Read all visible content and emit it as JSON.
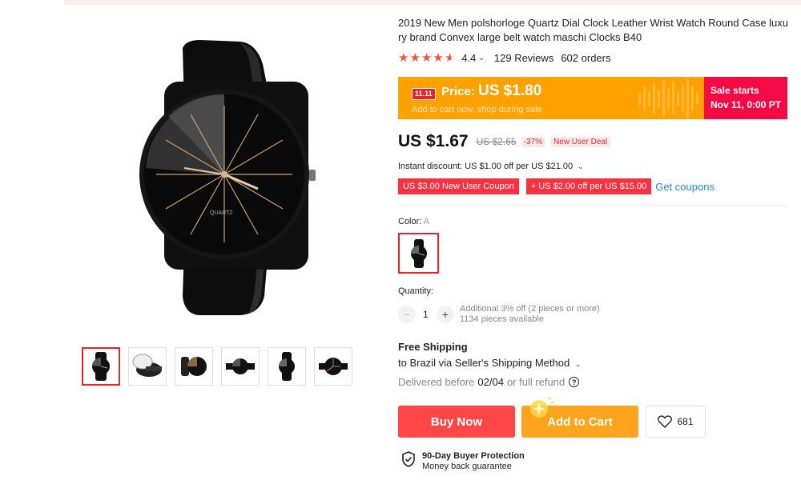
{
  "product": {
    "title": "2019 New Men polshorloge Quartz Dial Clock Leather Wrist Watch Round Case luxury brand Convex large belt watch maschi Clocks B40",
    "rating": "4.4",
    "rating_stars": 4.4,
    "reviews": "129 Reviews",
    "orders": "602 orders",
    "dial_brand": "QUARTZ"
  },
  "banner": {
    "tag": "11.11",
    "price_label": "Price:",
    "price": "US $1.80",
    "subtext": "Add to cart now, shop during sale",
    "sale_line1": "Sale starts",
    "sale_line2": "Nov 11, 0:00 PT",
    "color": "#ffa200",
    "accent": "#f50a45"
  },
  "pricing": {
    "price": "US $1.67",
    "old_price": "US $2.65",
    "discount": "-37%",
    "deal": "New User Deal",
    "instant_discount": "Instant discount: US $1.00 off per US $21.00",
    "coupon1": "US $3.00 New User Coupon",
    "coupon2": "+ US $2.00 off per US $15.00",
    "get_coupons": "Get coupons"
  },
  "variant": {
    "color_label": "Color:",
    "color_value": "A"
  },
  "quantity": {
    "label": "Quantity:",
    "value": "1",
    "note1": "Additional 3% off (2 pieces or more)",
    "note2": "1134 pieces available"
  },
  "shipping": {
    "title": "Free Shipping",
    "to": "to Brazil via Seller's Shipping Method",
    "delivered_prefix": "Delivered before",
    "delivered_date": "02/04",
    "delivered_suffix": "or full refund"
  },
  "actions": {
    "buy_now": "Buy Now",
    "add_to_cart": "Add to Cart",
    "wishlist_count": "681",
    "buy_color": "#ff4747",
    "cart_color": "#ffa41c"
  },
  "protection": {
    "title": "90-Day Buyer Protection",
    "subtitle": "Money back guarantee"
  }
}
